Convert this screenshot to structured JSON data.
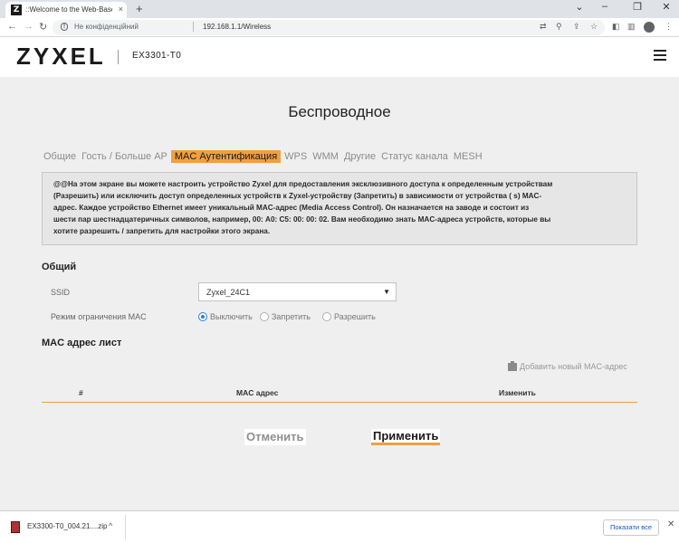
{
  "browser": {
    "tab_title": "::Welcome to the Web-Based Co",
    "tab_favicon": "Z",
    "tab_close": "×",
    "new_tab": "+",
    "window_controls": [
      "⌄",
      "–",
      "❐",
      "✕"
    ],
    "nav": {
      "back": "←",
      "forward": "→",
      "reload": "↻"
    },
    "security_label": "Не конфіденційний",
    "url": "192.168.1.1/Wireless"
  },
  "header": {
    "logo": "ZYXEL",
    "model": "EX3301-T0"
  },
  "page": {
    "title": "Беспроводное",
    "tabs": [
      {
        "label": "Общие",
        "active": false
      },
      {
        "label": "Гость / Больше AP",
        "active": false
      },
      {
        "label": "MAC Аутентификация",
        "active": true
      },
      {
        "label": "WPS",
        "active": false
      },
      {
        "label": "WMM",
        "active": false
      },
      {
        "label": "Другие",
        "active": false
      },
      {
        "label": "Статус канала",
        "active": false
      },
      {
        "label": "MESH",
        "active": false
      }
    ],
    "info_lines": [
      "@@На этом экране вы можете настроить устройство Zyxel для предоставления эксклюзивного доступа к определенным устройствам",
      "(Разрешить) или исключить доступ определенных устройств к Zyxel-устройству (Запретить) в зависимости от устройства ( s) MAC-",
      "адрес. Каждое устройство Ethernet имеет уникальный MAC-адрес (Media Access Control). Он назначается на заводе и состоит из",
      "шести пар шестнадцатеричных символов, например, 00: A0: C5: 00: 00: 02. Вам необходимо знать MAC-адреса устройств, которые вы",
      "хотите разрешить / запретить для настройки этого экрана."
    ],
    "general": {
      "section_title": "Общий",
      "ssid_label": "SSID",
      "ssid_value": "Zyxel_24C1",
      "mode_label": "Режим ограничения MAC",
      "mode_options": [
        {
          "label": "Выключить",
          "checked": true
        },
        {
          "label": "Запретить",
          "checked": false
        },
        {
          "label": "Разрешить",
          "checked": false
        }
      ]
    },
    "mac_list": {
      "section_title": "MAC адрес лист",
      "add_label": "Добавить новый MAC-адрес",
      "columns": [
        "#",
        "MAC адрес",
        "Изменить"
      ]
    },
    "buttons": {
      "cancel": "Отменить",
      "apply": "Применить"
    }
  },
  "download_shelf": {
    "file_name": "EX3300-T0_004.21....zip",
    "show_all": "Показати все",
    "close": "✕"
  },
  "colors": {
    "accent": "#f0a040",
    "radio_checked": "#2a7de1",
    "link": "#1a56b8"
  }
}
